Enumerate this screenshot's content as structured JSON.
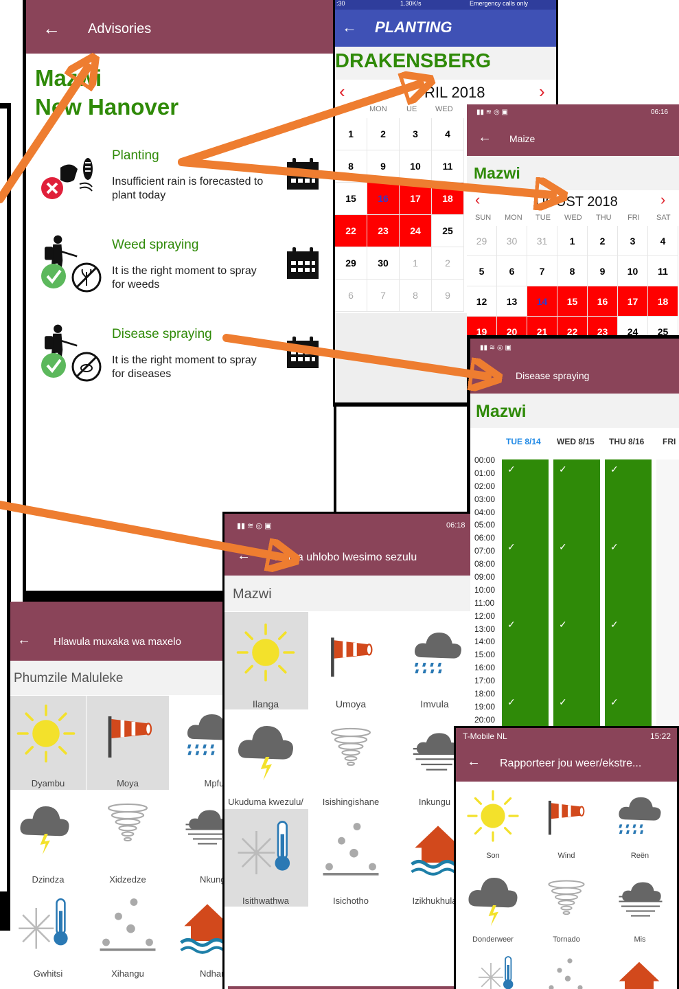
{
  "advisories": {
    "title": "Advisories",
    "location": "Mazwi",
    "sublocation": "New Hanover",
    "items": [
      {
        "name": "Planting",
        "text_line1": "Insufficient rain is forecasted to",
        "text_line2": "plant today",
        "status": "not-ok"
      },
      {
        "name": "Weed spraying",
        "text_line1": "It is the right moment to spray",
        "text_line2": "for weeds",
        "status": "ok"
      },
      {
        "name": "Disease spraying",
        "text_line1": "It is the right moment to spray",
        "text_line2": "for diseases",
        "status": "ok"
      }
    ]
  },
  "planting": {
    "status_bar": {
      "time": ":30",
      "speed": "1.30K/s",
      "right": "Emergency calls only"
    },
    "title": "PLANTING",
    "region": "DRAKENSBERG",
    "month": "RIL 2018",
    "day_names": [
      "MON",
      "UE",
      "WED"
    ],
    "rows": [
      [
        "1",
        "2",
        "3",
        "4"
      ],
      [
        "8",
        "9",
        "10",
        "11"
      ],
      [
        "15",
        "16",
        "17",
        "18"
      ],
      [
        "22",
        "23",
        "24",
        "25"
      ],
      [
        "29",
        "30",
        "1",
        "2"
      ],
      [
        "6",
        "7",
        "8",
        "9"
      ]
    ]
  },
  "maize": {
    "status_time": "06:16",
    "title": "Maize",
    "location": "Mazwi",
    "month": "UGUST 2018",
    "day_names": [
      "SUN",
      "MON",
      "TUE",
      "WED",
      "THU",
      "FRI",
      "SAT"
    ],
    "rows": [
      [
        "29",
        "30",
        "31",
        "1",
        "2",
        "3",
        "4"
      ],
      [
        "5",
        "6",
        "7",
        "8",
        "9",
        "10",
        "11"
      ],
      [
        "12",
        "13",
        "14",
        "15",
        "16",
        "17",
        "18"
      ],
      [
        "19",
        "20",
        "21",
        "22",
        "23",
        "24",
        "25"
      ]
    ]
  },
  "disease": {
    "title": "Disease spraying",
    "location": "Mazwi",
    "days": [
      "TUE 8/14",
      "WED 8/15",
      "THU 8/16",
      "FRI"
    ],
    "hours": [
      "00:00",
      "01:00",
      "02:00",
      "03:00",
      "04:00",
      "05:00",
      "06:00",
      "07:00",
      "08:00",
      "09:00",
      "10:00",
      "11:00",
      "12:00",
      "13:00",
      "14:00",
      "15:00",
      "16:00",
      "17:00",
      "18:00",
      "19:00",
      "20:00"
    ],
    "check": "✓"
  },
  "zulu": {
    "status_time": "06:18",
    "title": "Ketha uhlobo lwesimo sezulu",
    "location": "Mazwi",
    "tiles": [
      "Ilanga",
      "Umoya",
      "Imvula",
      "Ukuduma kwezulu/",
      "Isishingishane",
      "Inkungu",
      "Isithwathwa",
      "Isichotho",
      "Izikhukhula"
    ]
  },
  "tsonga": {
    "title": "Hlawula muxaka wa maxelo",
    "location": "Phumzile Maluleke",
    "tiles": [
      "Dyambu",
      "Moya",
      "Mpfula",
      "Dzindza",
      "Xidzedze",
      "Nkungha",
      "Gwhitsi",
      "Xihangu",
      "Ndhambi"
    ]
  },
  "afrikaans": {
    "status_left": "T-Mobile  NL",
    "status_time": "15:22",
    "title": "Rapporteer jou weer/ekstre...",
    "tiles": [
      "Son",
      "Wind",
      "Reën",
      "Donderweer",
      "Tornado",
      "Mis"
    ]
  },
  "colors": {
    "maroon": "#8a4459",
    "green": "#2f8a08",
    "red": "#ff0000",
    "orange": "#ee7d30",
    "blue_bar": "#3f51b5"
  }
}
